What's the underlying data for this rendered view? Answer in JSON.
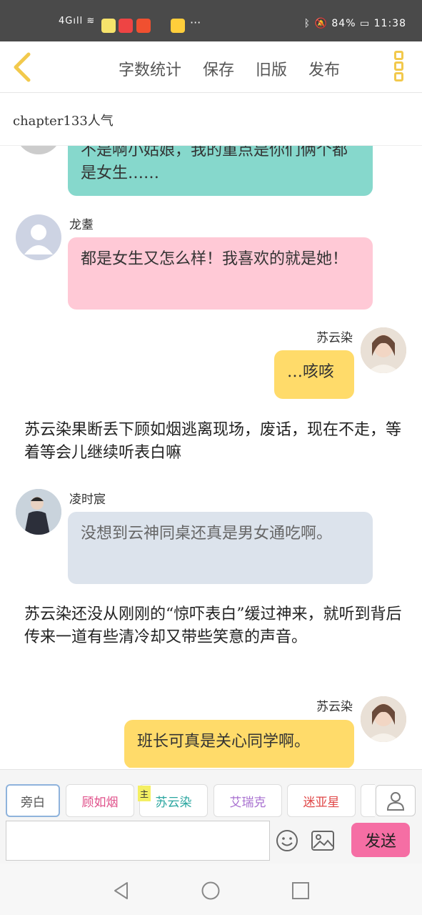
{
  "status_bar": {
    "signal": "4G",
    "battery": "84%",
    "time": "11:38"
  },
  "toolbar": {
    "word_count": "字数统计",
    "save": "保存",
    "old_version": "旧版",
    "publish": "发布"
  },
  "chapter_title": "chapter133人气",
  "messages": [
    {
      "type": "left",
      "speaker": "",
      "text": "不是啊小姑娘，我的重点是你们俩个都是女生……",
      "color": "#86d8cc"
    },
    {
      "type": "left",
      "speaker": "龙耋",
      "text": "都是女生又怎么样！我喜欢的就是她！",
      "color": "#ffc9d6"
    },
    {
      "type": "right",
      "speaker": "苏云染",
      "text": "…咳咳",
      "color": "#ffdb6a"
    },
    {
      "type": "narration",
      "text": "苏云染果断丢下顾如烟逃离现场，废话，现在不走，等着等会儿继续听表白嘛"
    },
    {
      "type": "left",
      "speaker": "凌时宸",
      "text": "没想到云神同桌还真是男女通吃啊。",
      "color": "#dce3ec"
    },
    {
      "type": "narration",
      "text": "苏云染还没从刚刚的“惊吓表白”缓过神来，就听到背后传来一道有些清冷却又带些笑意的声音。"
    },
    {
      "type": "right",
      "speaker": "苏云染",
      "text": "班长可真是关心同学啊。",
      "color": "#ffdb6a"
    }
  ],
  "roles": [
    {
      "label": "旁白",
      "color": "#555555"
    },
    {
      "label": "顾如烟",
      "color": "#e0508a"
    },
    {
      "label": "苏云染",
      "color": "#2aa6a0"
    },
    {
      "label": "艾瑞克",
      "color": "#a870d0"
    },
    {
      "label": "迷亚星",
      "color": "#e04848"
    }
  ],
  "main_tag": "主",
  "input": {
    "value": "",
    "placeholder": ""
  },
  "send_label": "发送",
  "icons": {
    "back": "chevron-left-icon",
    "menu": "more-vertical-icon",
    "person": "person-icon",
    "emoji": "smiley-icon",
    "image": "image-icon"
  },
  "accent": "#f2c94c"
}
